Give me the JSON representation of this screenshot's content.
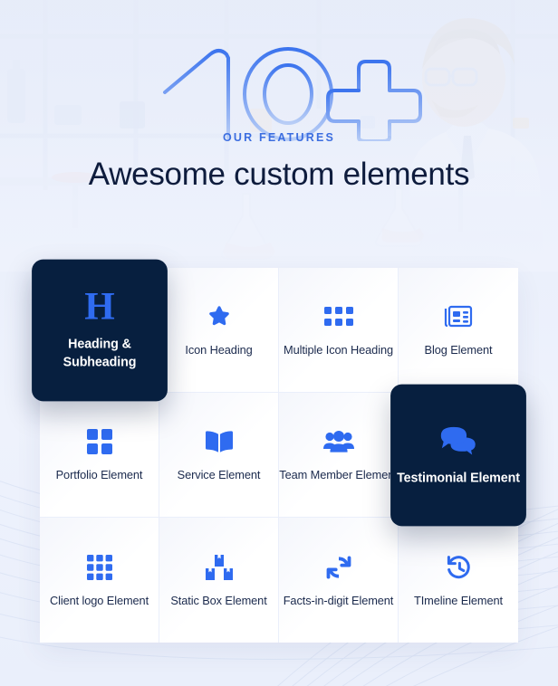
{
  "hero": {
    "big_number": "10+",
    "eyebrow": "OUR FEATURES",
    "title": "Awesome custom elements"
  },
  "colors": {
    "accent_blue": "#2f6bf0",
    "eyebrow_blue": "#3c6ee0",
    "dark_navy": "#071f3f",
    "heading_navy": "#0e1c3d",
    "page_bg": "#eef2fc",
    "card_bg": "#ffffff"
  },
  "grid": {
    "columns": 4,
    "rows": 3,
    "cards": [
      {
        "label": "Heading & Subheading",
        "icon": "letter-h-icon",
        "active": true
      },
      {
        "label": "Icon Heading",
        "icon": "star-icon",
        "active": false
      },
      {
        "label": "Multiple Icon Heading",
        "icon": "dots-grid-icon",
        "active": false
      },
      {
        "label": "Blog Element",
        "icon": "newspaper-icon",
        "active": false
      },
      {
        "label": "Portfolio Element",
        "icon": "four-squares-icon",
        "active": false
      },
      {
        "label": "Service Element",
        "icon": "open-book-icon",
        "active": false
      },
      {
        "label": "Team Member Element",
        "icon": "people-group-icon",
        "active": false
      },
      {
        "label": "Testimonial Element",
        "icon": "chat-bubbles-icon",
        "active": true
      },
      {
        "label": "Client logo Element",
        "icon": "nine-squares-icon",
        "active": false
      },
      {
        "label": "Static Box Element",
        "icon": "stacked-boxes-icon",
        "active": false
      },
      {
        "label": "Facts-in-digit Element",
        "icon": "refresh-arrows-icon",
        "active": false
      },
      {
        "label": "TImeline Element",
        "icon": "history-clock-icon",
        "active": false
      }
    ]
  }
}
